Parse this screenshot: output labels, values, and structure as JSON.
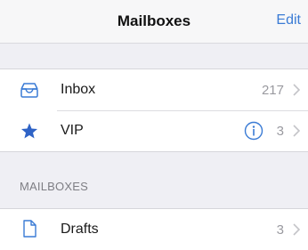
{
  "navbar": {
    "title": "Mailboxes",
    "edit_label": "Edit"
  },
  "top_group": {
    "items": [
      {
        "label": "Inbox",
        "count": "217",
        "icon": "inbox-tray-icon"
      },
      {
        "label": "VIP",
        "count": "3",
        "icon": "star-icon",
        "info_icon": "info-icon"
      }
    ]
  },
  "mailboxes_section": {
    "header": "MAILBOXES",
    "items": [
      {
        "label": "Drafts",
        "count": "3",
        "icon": "document-icon"
      }
    ]
  },
  "colors": {
    "accent": "#3a7bd5",
    "background": "#efeff4",
    "secondary_text": "#9a9aa0"
  }
}
